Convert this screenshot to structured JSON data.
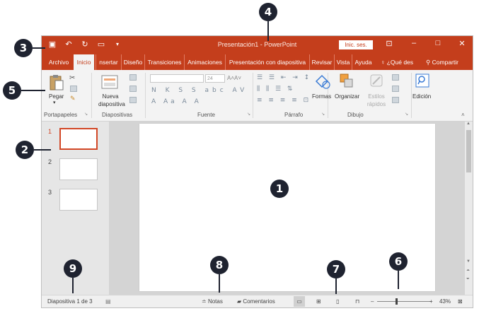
{
  "window": {
    "title": "Presentación1 - PowerPoint",
    "signin_label": "Inic. ses."
  },
  "qat": {
    "icons": [
      "save-icon",
      "undo-icon",
      "redo-icon",
      "start-presentation-icon",
      "customize-qat-icon"
    ]
  },
  "tabs": [
    {
      "label": "Archivo",
      "active": false
    },
    {
      "label": "Inicio",
      "active": true
    },
    {
      "label": "nsertar",
      "active": false
    },
    {
      "label": "Diseño",
      "active": false
    },
    {
      "label": "Transiciones",
      "active": false
    },
    {
      "label": "Animaciones",
      "active": false
    },
    {
      "label": "Presentación con diapositiva",
      "active": false
    },
    {
      "label": "Revisar",
      "active": false
    },
    {
      "label": "Vista",
      "active": false
    },
    {
      "label": "Ayuda",
      "active": false
    },
    {
      "label": "¿Qué des",
      "active": false
    },
    {
      "label": "Compartir",
      "active": false
    }
  ],
  "ribbon": {
    "clipboard": {
      "paste_label": "Pegar",
      "group_label": "Portapapeles"
    },
    "slides": {
      "new_slide_label": "Nueva diapositiva",
      "group_label": "Diapositivas"
    },
    "font": {
      "size_value": "24",
      "format_buttons": "N K S S abc AV",
      "case_buttons": "A Aa A A",
      "group_label": "Fuente"
    },
    "paragraph": {
      "group_label": "Párrafo"
    },
    "drawing": {
      "shapes_label": "Formas",
      "arrange_label": "Organizar",
      "quick_styles_label": "Estilos rápidos",
      "group_label": "Dibujo"
    },
    "editing": {
      "label": "Edición"
    }
  },
  "slides_pane": {
    "numbers": [
      "1",
      "2",
      "3"
    ],
    "selected": 1
  },
  "status": {
    "slide_info": "Diapositiva 1 de 3",
    "notes_label": "Notas",
    "comments_label": "Comentarios",
    "zoom": "43%"
  },
  "callouts": [
    "1",
    "2",
    "3",
    "4",
    "5",
    "6",
    "7",
    "8",
    "9"
  ],
  "colors": {
    "accent": "#c43e1c",
    "selection": "#d24726",
    "callout": "#1f2330"
  }
}
